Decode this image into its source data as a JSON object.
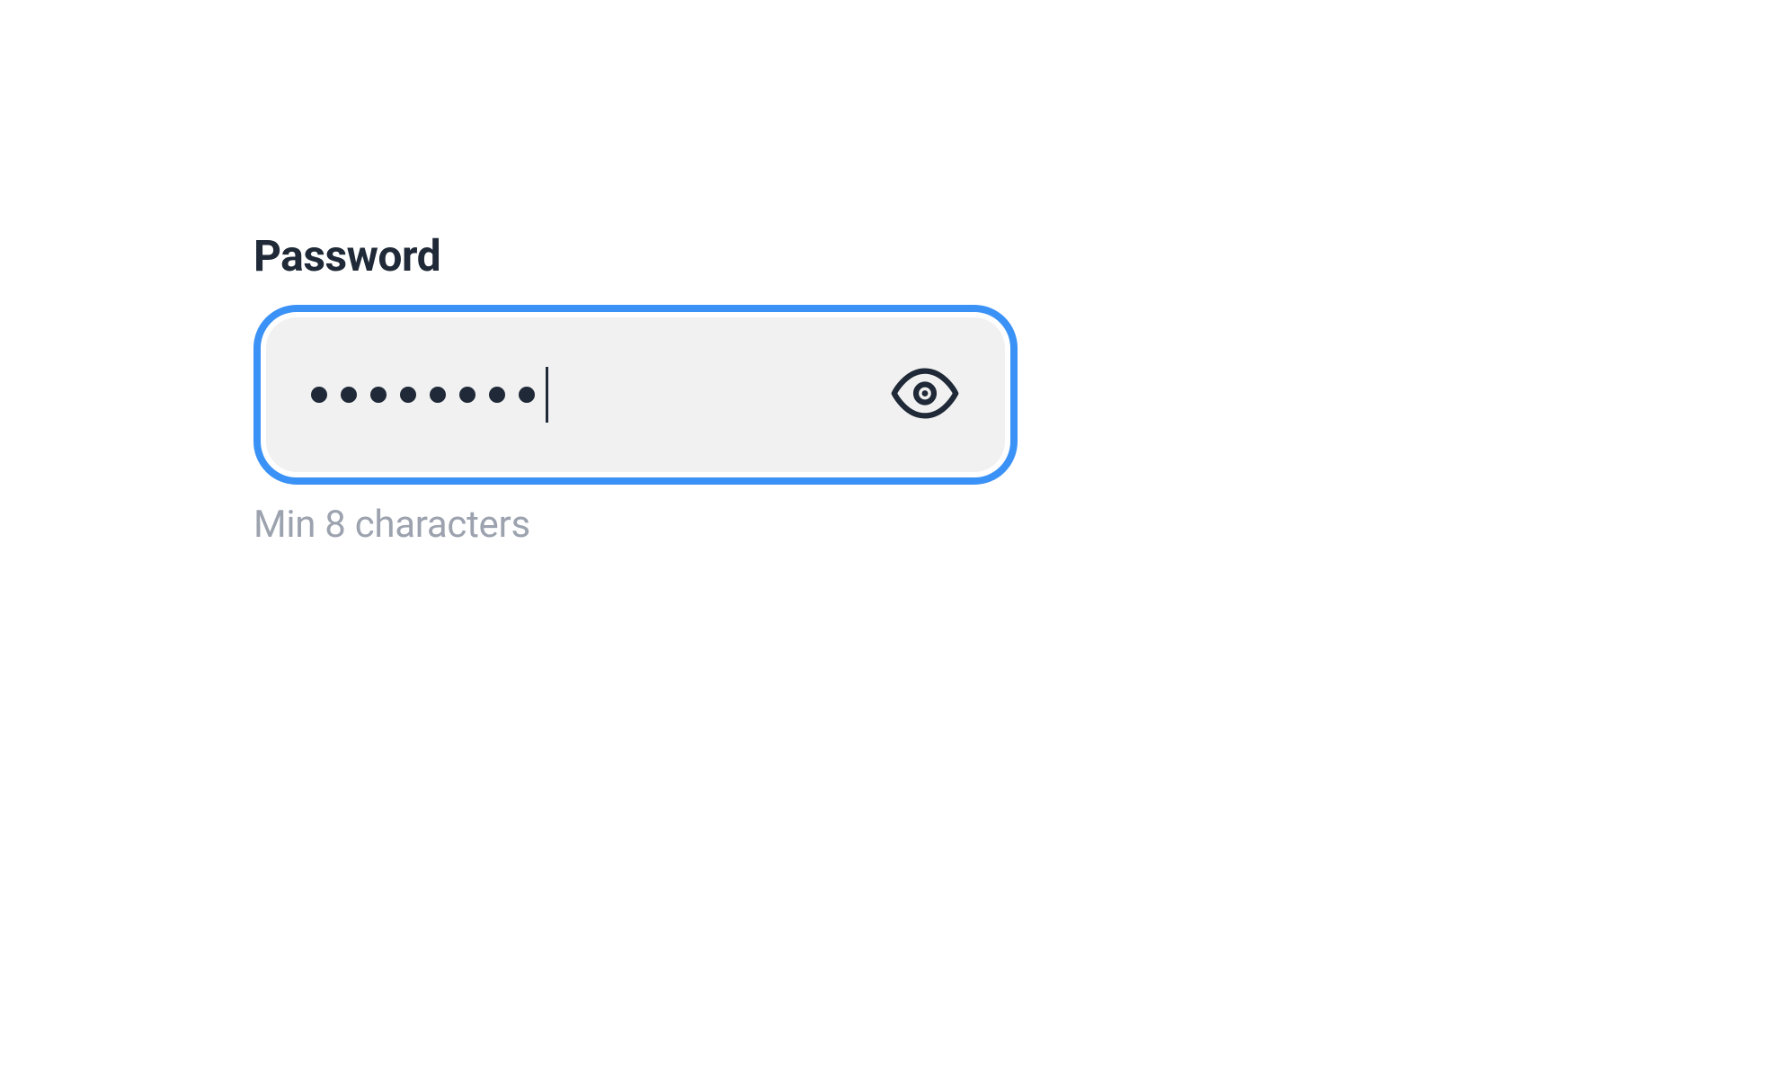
{
  "password_field": {
    "label": "Password",
    "value": "********",
    "masked_char_count": 8,
    "hint": "Min 8 characters",
    "show_password_icon": "eye-icon"
  }
}
